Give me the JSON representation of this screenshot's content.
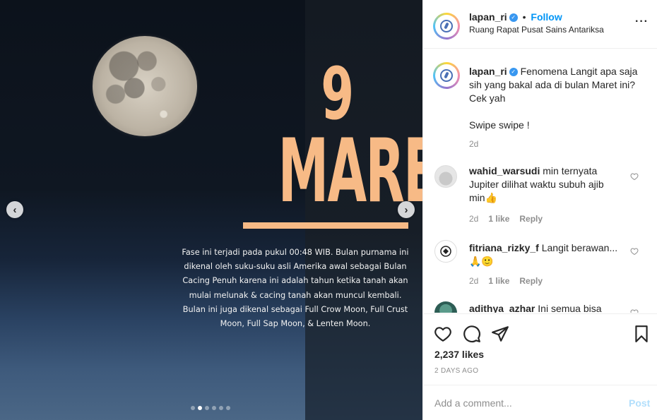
{
  "media": {
    "big_number": "9",
    "big_month": "MARET",
    "description_lines": [
      "Fase ini terjadi pada pukul 00:48 WIB. Bulan purnama ini",
      "dikenal oleh suku-suku asli Amerika awal sebagai Bulan",
      "Cacing Penuh karena ini adalah tahun ketika tanah akan",
      "mulai melunak & cacing tanah akan muncul kembali.",
      "Bulan ini juga dikenal sebagai Full Crow Moon, Full Crust",
      "Moon, Full Sap Moon, & Lenten Moon."
    ],
    "prev_icon": "chevron-left-icon",
    "next_icon": "chevron-right-icon",
    "prev_glyph": "‹",
    "next_glyph": "›",
    "slide_count": 6,
    "active_slide": 2
  },
  "header": {
    "username": "lapan_ri",
    "dot": "•",
    "follow_label": "Follow",
    "location": "Ruang Rapat Pusat Sains Antariksa",
    "more_glyph": "···"
  },
  "caption": {
    "username": "lapan_ri",
    "text_line1": "Fenomena Langit apa saja",
    "text_line2": "sih yang bakal ada di bulan Maret ini?",
    "text_line3": "Cek yah",
    "text_line4": "Swipe swipe !",
    "time": "2d"
  },
  "comments": [
    {
      "username": "wahid_warsudi",
      "line1": "min ternyata",
      "line2": "Jupiter dilihat waktu subuh ajib",
      "line3": "min👍",
      "time": "2d",
      "likes": "1 like",
      "reply": "Reply"
    },
    {
      "username": "fitriana_rizky_f",
      "line1": "Langit berawan...",
      "line2": "🙏🙂",
      "time": "2d",
      "likes": "1 like",
      "reply": "Reply"
    },
    {
      "username": "adithya_azhar",
      "line1": "Ini semua bisa"
    }
  ],
  "actions": {
    "likes": "2,237 likes",
    "date": "2 DAYS AGO"
  },
  "comment_box": {
    "placeholder": "Add a comment...",
    "post_label": "Post"
  },
  "colors": {
    "accent_orange": "#f7ba86",
    "link_blue": "#0095f6",
    "post_disabled": "#b2dffc",
    "verified_blue": "#3897f0"
  }
}
